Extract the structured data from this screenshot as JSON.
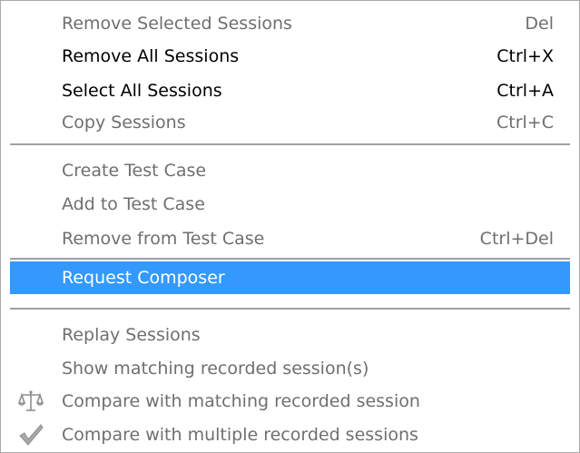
{
  "menu": {
    "items": [
      {
        "label": "Remove Selected Sessions",
        "shortcut": "Del",
        "state": "disabled"
      },
      {
        "label": "Remove All Sessions",
        "shortcut": "Ctrl+X",
        "state": "enabled"
      },
      {
        "label": "Select All Sessions",
        "shortcut": "Ctrl+A",
        "state": "enabled"
      },
      {
        "label": "Copy Sessions",
        "shortcut": "Ctrl+C",
        "state": "disabled"
      },
      {
        "label": "Create Test Case",
        "shortcut": "",
        "state": "disabled"
      },
      {
        "label": "Add to Test Case",
        "shortcut": "",
        "state": "disabled"
      },
      {
        "label": "Remove from Test Case",
        "shortcut": "Ctrl+Del",
        "state": "disabled"
      },
      {
        "label": "Request Composer",
        "shortcut": "",
        "state": "highlighted"
      },
      {
        "label": "Replay Sessions",
        "shortcut": "",
        "state": "disabled"
      },
      {
        "label": "Show matching recorded session(s)",
        "shortcut": "",
        "state": "disabled"
      },
      {
        "label": "Compare with matching recorded session",
        "shortcut": "",
        "state": "disabled",
        "icon": "scales-icon"
      },
      {
        "label": "Compare with multiple recorded sessions",
        "shortcut": "",
        "state": "disabled",
        "icon": "checkmark-icon"
      }
    ]
  },
  "colors": {
    "highlight": "#3399ff",
    "disabled_text": "#6f6f6f",
    "enabled_text": "#000000",
    "separator": "#a0a0a0"
  }
}
